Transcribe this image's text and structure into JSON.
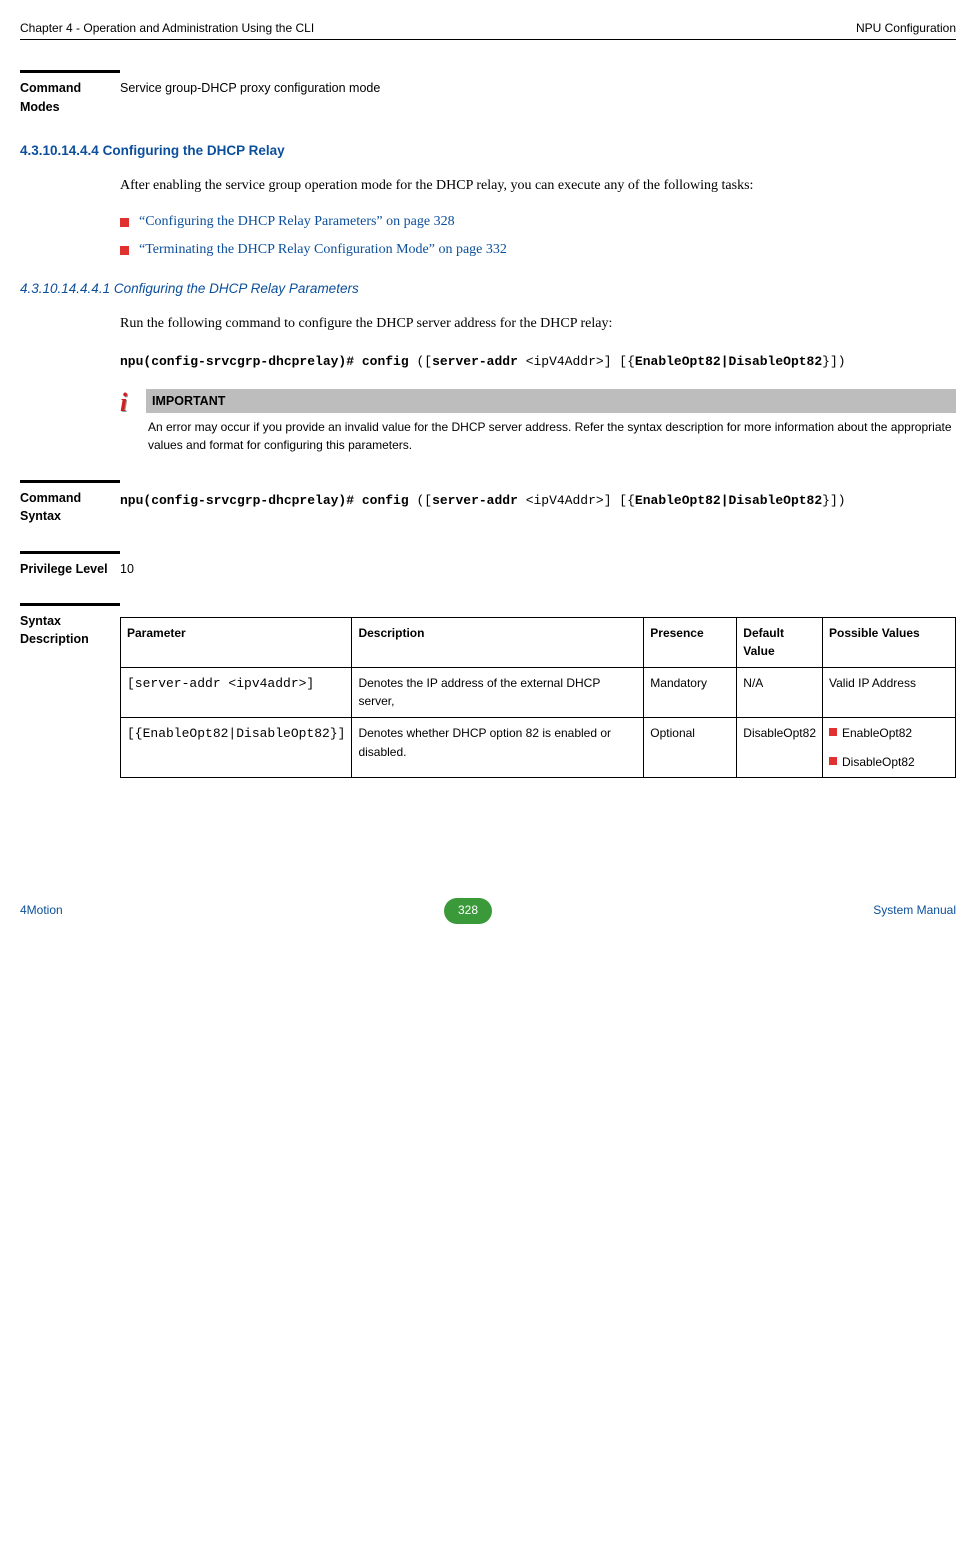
{
  "header": {
    "left": "Chapter 4 - Operation and Administration Using the CLI",
    "right": "NPU Configuration"
  },
  "cmdModes": {
    "label": "Command Modes",
    "text": "Service group-DHCP proxy configuration mode"
  },
  "h4": {
    "num": "4.3.10.14.4.4",
    "title": "Configuring the DHCP Relay",
    "intro": "After enabling the service group operation mode for the DHCP relay, you can execute any of the following tasks:"
  },
  "bullets": [
    "“Configuring the DHCP Relay Parameters” on page 328",
    "“Terminating the DHCP Relay Configuration Mode” on page 332"
  ],
  "h5": {
    "num": "4.3.10.14.4.4.1",
    "title": "Configuring the DHCP Relay Parameters",
    "intro": "Run the following command to configure the DHCP server address for the DHCP relay:"
  },
  "cmd": {
    "p1a": "npu(config-srvcgrp-dhcprelay)# config",
    "p1b": " ([",
    "p1c": "server-addr",
    "p1d": " <ipV4Addr>] [{",
    "p1e": "EnableOpt82|DisableOpt82",
    "p1f": "}])"
  },
  "important": {
    "label": "IMPORTANT",
    "text": "An error may occur if you provide an invalid value for the DHCP server address. Refer the syntax description for more information about the appropriate values and format for configuring this parameters."
  },
  "cmdSyntax": {
    "label": "Command Syntax"
  },
  "privilege": {
    "label": "Privilege Level",
    "value": "10"
  },
  "syntaxDesc": {
    "label": "Syntax Description",
    "headers": {
      "param": "Parameter",
      "desc": "Description",
      "presence": "Presence",
      "default": "Default Value",
      "possible": "Possible Values"
    },
    "rows": [
      {
        "param": "[server-addr <ipv4addr>]",
        "desc": "Denotes the IP address of the external DHCP server,",
        "presence": "Mandatory",
        "default": "N/A",
        "possible_plain": "Valid IP Address"
      },
      {
        "param": "[{EnableOpt82|DisableOpt82}]",
        "desc": "Denotes whether DHCP option 82 is enabled or disabled.",
        "presence": "Optional",
        "default": "DisableOpt82",
        "possible_list": [
          "EnableOpt82",
          "DisableOpt82"
        ]
      }
    ]
  },
  "footer": {
    "left": "4Motion",
    "page": "328",
    "right": "System Manual"
  }
}
